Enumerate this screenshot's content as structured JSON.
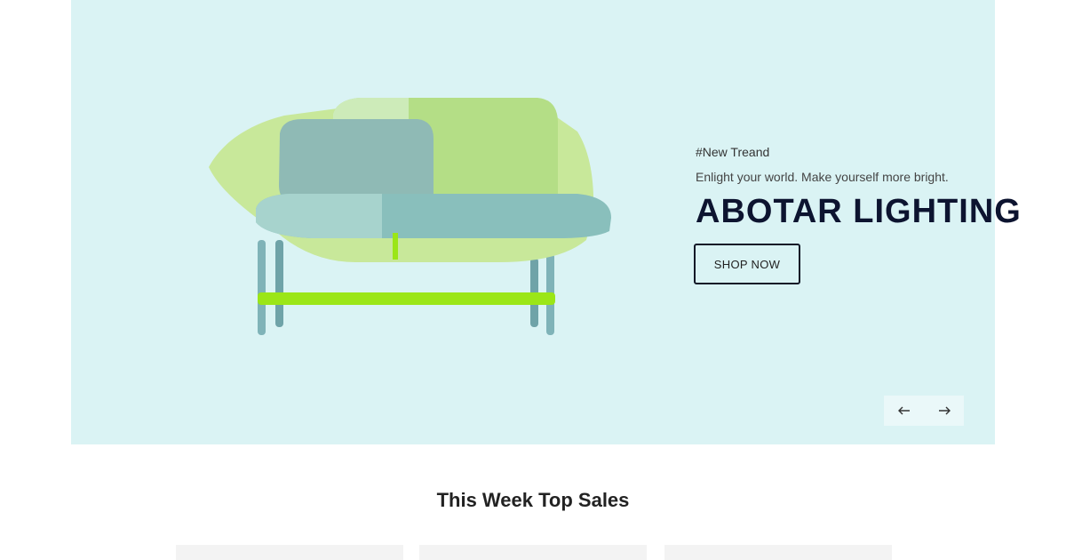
{
  "hero": {
    "tag": "#New Treand",
    "subtitle": "Enlight your world. Make yourself more bright.",
    "headline": "ABOTAR LIGHTING",
    "cta_label": "SHOP NOW",
    "background": "#daf3f4",
    "image_subject": "sofa-icon",
    "prev_icon": "arrow-left-icon",
    "next_icon": "arrow-right-icon"
  },
  "section": {
    "title": "This Week Top Sales"
  },
  "colors": {
    "headline": "#0d1430",
    "sofa_body": "#c8e89a",
    "sofa_cushion": "#8fc0bd",
    "sofa_accent": "#9be617",
    "sofa_legs": "#7fb3b8"
  }
}
